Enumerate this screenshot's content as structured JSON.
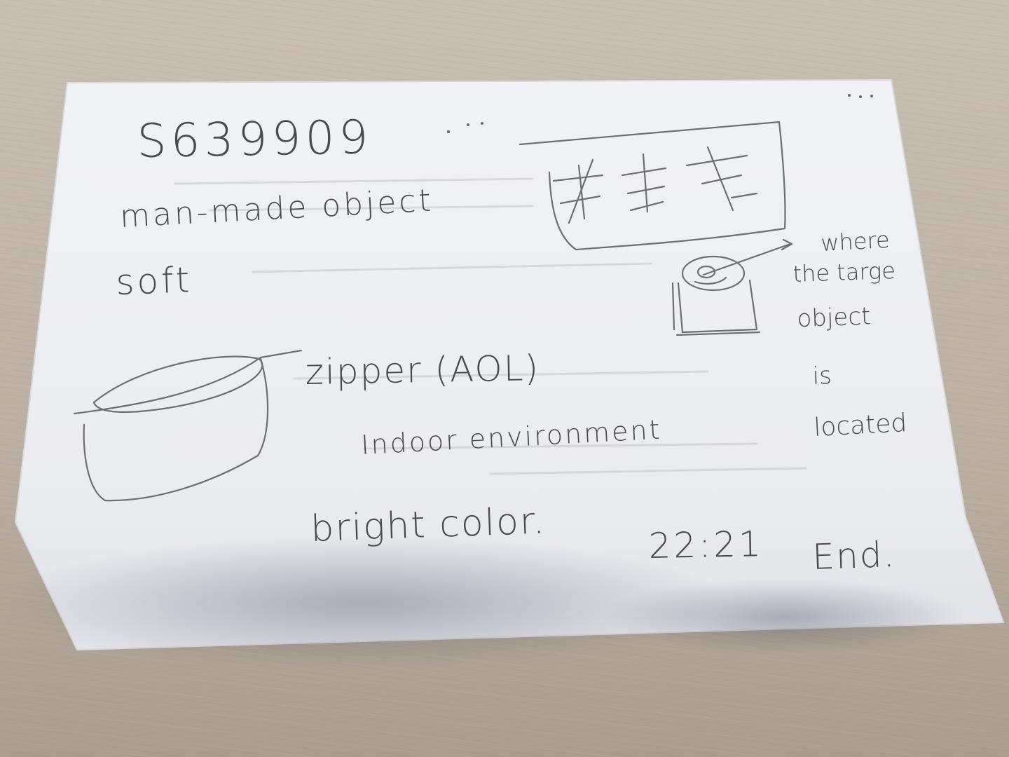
{
  "colors": {
    "table": "#c2b8ab",
    "paper": "#eeeff3",
    "pencil": "#4a4a4e"
  },
  "note": {
    "id_number": "S639909",
    "line_category": "man-made object",
    "line_texture": "soft",
    "label_zipper": "zipper (AOL)",
    "line_environment": "Indoor environment",
    "line_color": "bright color.",
    "label_where_1": "where",
    "label_where_2": "the targe",
    "label_where_3": "object",
    "label_where_4": "is",
    "label_where_5": "located",
    "time": "22:21",
    "end": "End."
  },
  "sketches": {
    "cabinet_sketch": "cabinet-with-characters",
    "target_sketch": "cup-with-target-circle",
    "bag_sketch": "bag-with-zipper"
  }
}
